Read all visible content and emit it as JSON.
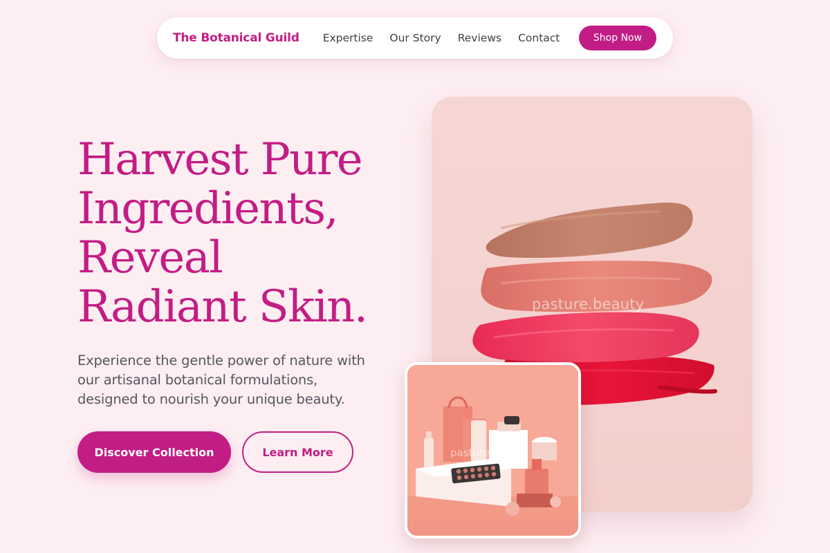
{
  "nav": {
    "brand": "The Botanical Guild",
    "links": [
      "Expertise",
      "Our Story",
      "Reviews",
      "Contact"
    ],
    "cta": "Shop Now"
  },
  "hero": {
    "headline_lines": [
      "Harvest Pure",
      "Ingredients,",
      "Reveal",
      "Radiant Skin."
    ],
    "subtext_lines": [
      "Experience the gentle power of nature with",
      "our artisanal botanical formulations,",
      "designed to nourish your unique beauty."
    ],
    "primary_cta": "Discover Collection",
    "secondary_cta": "Learn More"
  },
  "images": {
    "main_watermark": "pasture.beauty",
    "small_watermark": "pasture"
  },
  "colors": {
    "accent": "#c21d84",
    "background": "#fdeef2",
    "body_text": "#56565e",
    "nav_text": "#3f3f46"
  }
}
